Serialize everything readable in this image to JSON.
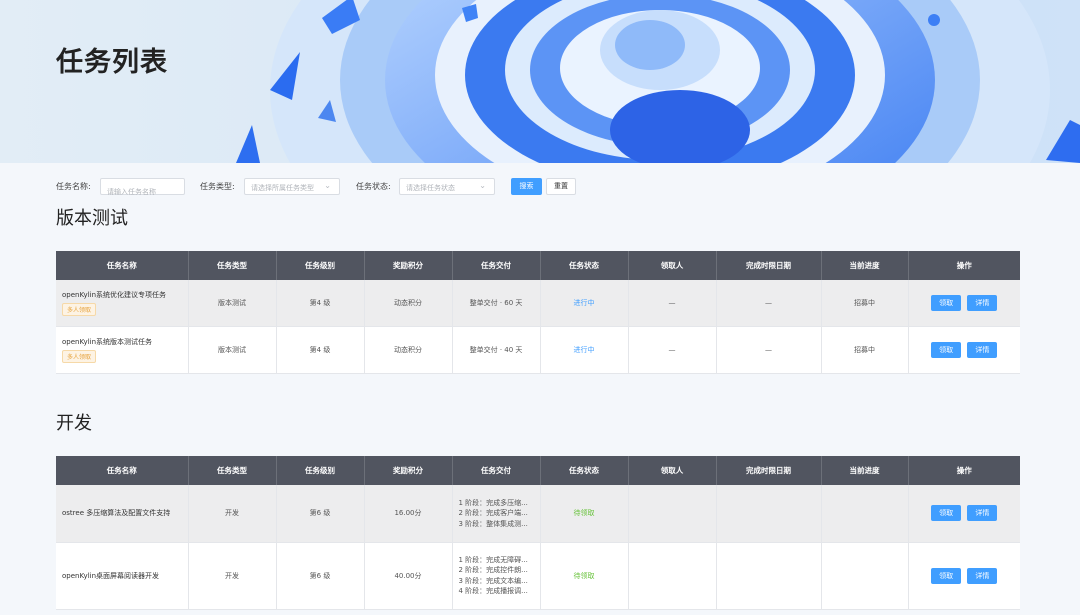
{
  "page": {
    "title": "任务列表"
  },
  "filter": {
    "name_label": "任务名称:",
    "name_placeholder": "请输入任务名称",
    "type_label": "任务类型:",
    "type_placeholder": "请选择所属任务类型",
    "status_label": "任务状态:",
    "status_placeholder": "请选择任务状态",
    "search_label": "搜索",
    "reset_label": "重置"
  },
  "columns": [
    "任务名称",
    "任务类型",
    "任务级别",
    "奖励积分",
    "任务交付",
    "任务状态",
    "领取人",
    "完成时限日期",
    "当前进度",
    "操作"
  ],
  "actions": {
    "claim": "领取",
    "detail": "详情"
  },
  "sections": [
    {
      "title": "版本测试",
      "rows": [
        {
          "name": "openKylin系统优化建议专项任务",
          "tag": "多人领取",
          "type": "版本测试",
          "level": "第4 级",
          "points": "动态积分",
          "delivery": "整单交付 · 60 天",
          "status": "进行中",
          "assignee": "—",
          "deadline": "—",
          "progress": "招募中"
        },
        {
          "name": "openKylin系统版本测试任务",
          "tag": "多人领取",
          "type": "版本测试",
          "level": "第4 级",
          "points": "动态积分",
          "delivery": "整单交付 · 40 天",
          "status": "进行中",
          "assignee": "—",
          "deadline": "—",
          "progress": "招募中"
        }
      ]
    },
    {
      "title": "开发",
      "rows": [
        {
          "name": "ostree 多压缩算法及配置文件支持",
          "type": "开发",
          "level": "第6 级",
          "points": "16.00分",
          "stages": [
            "1 阶段：完成多压缩...",
            "2 阶段：完成客户端...",
            "3 阶段：整体集成测..."
          ],
          "status": "待领取",
          "assignee": "",
          "deadline": "",
          "progress": ""
        },
        {
          "name": "openKylin桌面屏幕阅读器开发",
          "type": "开发",
          "level": "第6 级",
          "points": "40.00分",
          "stages": [
            "1 阶段：完成无障碍...",
            "2 阶段：完成控件朗...",
            "3 阶段：完成文本编...",
            "4 阶段：完成播报调..."
          ],
          "status": "待领取",
          "assignee": "",
          "deadline": "",
          "progress": ""
        }
      ]
    }
  ],
  "colors": {
    "primary": "#409eff",
    "header_bg": "#515560",
    "in_progress": "#409eff",
    "pending": "#67c23a",
    "tag": "#e6a23c"
  }
}
